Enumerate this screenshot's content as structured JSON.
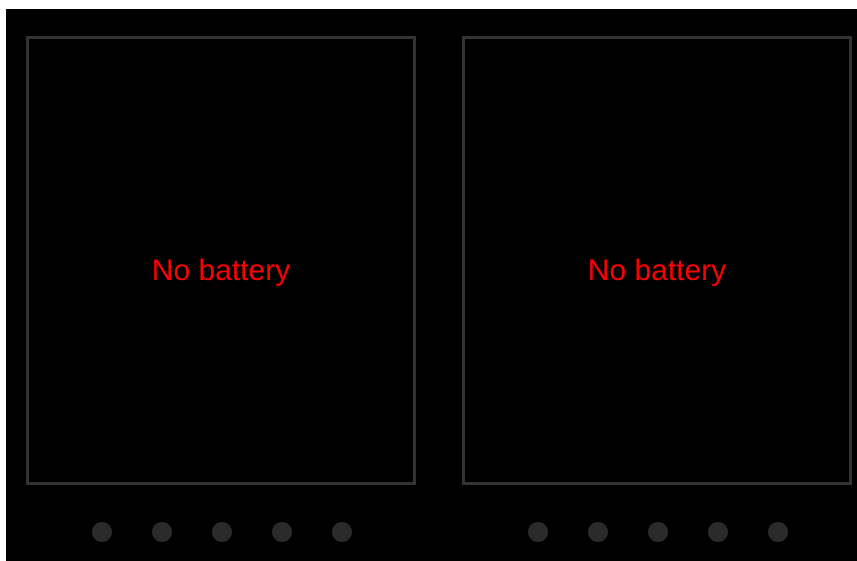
{
  "colors": {
    "background": "#000000",
    "slot_border": "#333333",
    "status_text": "#ff0000",
    "indicator_off": "#2a2a2a"
  },
  "slots": [
    {
      "status": "No battery",
      "indicators": [
        "off",
        "off",
        "off",
        "off",
        "off"
      ]
    },
    {
      "status": "No battery",
      "indicators": [
        "off",
        "off",
        "off",
        "off",
        "off"
      ]
    }
  ]
}
